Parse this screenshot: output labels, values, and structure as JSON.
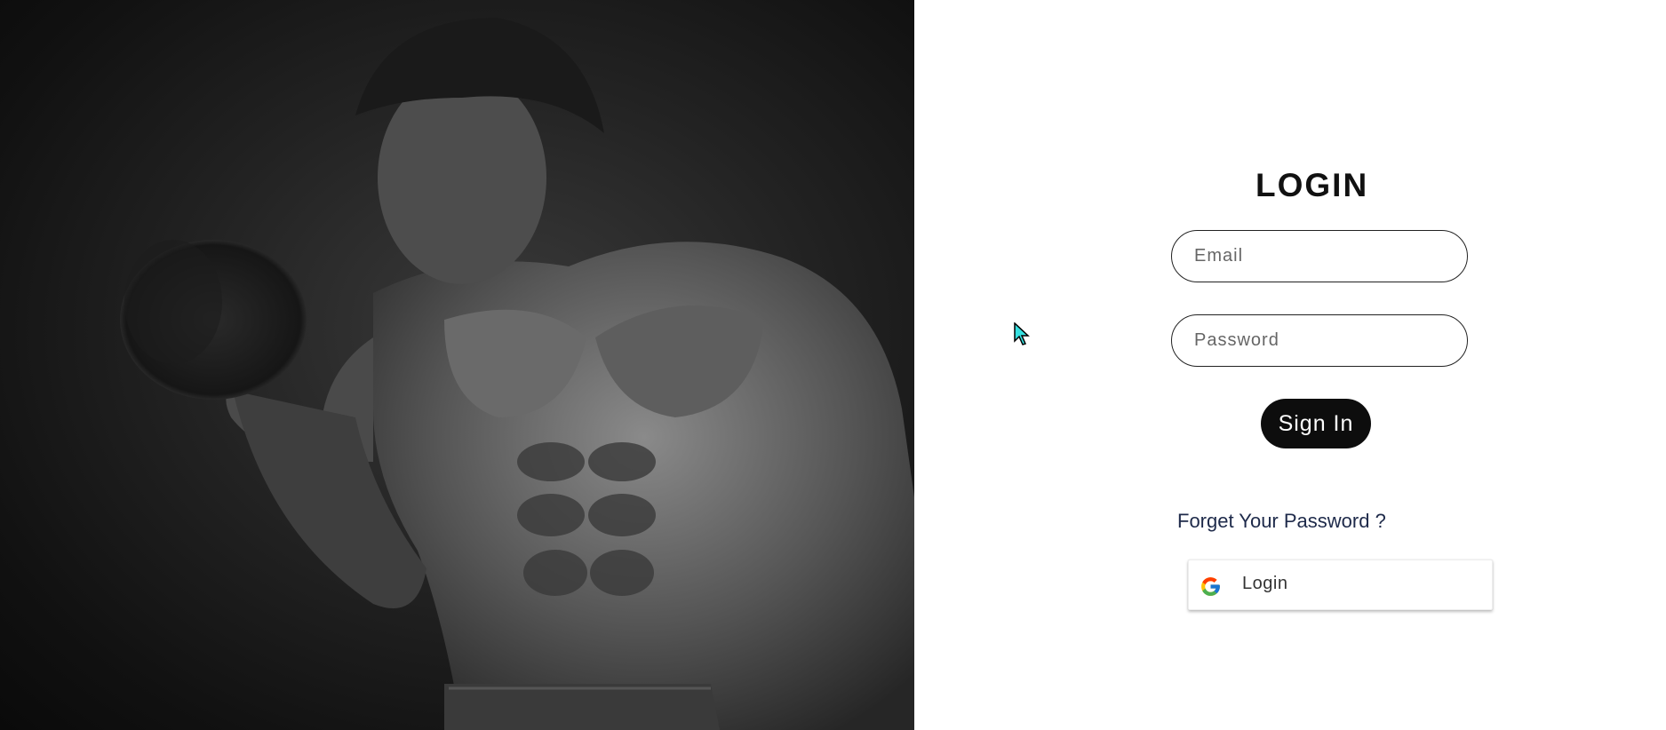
{
  "hero": {
    "image_description_icon": "bodybuilder-photo"
  },
  "login": {
    "title": "LOGIN",
    "email_placeholder": "Email",
    "email_value": "",
    "password_placeholder": "Password",
    "password_value": "",
    "signin_label": "Sign In",
    "forgot_label": "Forget Your Password ?",
    "google_label": "Login",
    "google_icon": "google-icon"
  },
  "colors": {
    "primary_button": "#0d0d0d",
    "link": "#1e2a4a",
    "field_border": "#222222"
  }
}
